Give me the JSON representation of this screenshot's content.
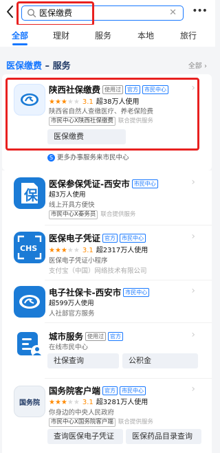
{
  "search": {
    "query": "医保缴费"
  },
  "tabs": [
    "全部",
    "理财",
    "服务",
    "本地",
    "旅行"
  ],
  "section": {
    "keyword": "医保缴费",
    "suffix": "– 服务",
    "all": "全部 ›"
  },
  "colors": {
    "accent": "#1677ff",
    "highlight": "#e8201f",
    "star": "#ff8a00"
  },
  "items": [
    {
      "title": "陕西社保缴费",
      "badges": [
        "使用过",
        "官方",
        "市民中心"
      ],
      "rating": "3.1",
      "users": "超38万人使用",
      "desc": "陕西省自然人查缴医疗、养老保险费",
      "tag": "市民中心X陕西社保缴费",
      "source": "联合提供服务",
      "actions": [
        "医保缴费"
      ],
      "icon": "si-social-security-icon"
    },
    {
      "hint": "更多办事服务来市民中心"
    },
    {
      "title": "医保参保凭证-西安市",
      "badges": [
        "市民中心"
      ],
      "users": "超3万人使用",
      "desc": "线上开具方便快",
      "tag": "市民中心X秦务员",
      "source": "联合提供服务",
      "icon": "bao-document-icon"
    },
    {
      "title": "医保电子凭证",
      "badges": [
        "官方",
        "市民中心"
      ],
      "rating": "3.1",
      "users": "超2317万人使用",
      "desc": "医保电子凭证小程序",
      "provider": "支付宝（中国）网络技术有限公司",
      "icon": "chs-icon"
    },
    {
      "title": "电子社保卡-西安市",
      "badges": [
        "市民中心"
      ],
      "users": "超599万人使用",
      "desc": "人社部官方服务",
      "icon": "si-card-icon"
    },
    {
      "title": "城市服务",
      "badges": [
        "使用过",
        "官方"
      ],
      "desc": "在线市民中心",
      "actions": [
        "社保查询",
        "公积金"
      ],
      "icon": "city-service-icon"
    },
    {
      "title": "国务院客户端",
      "badges": [
        "官方",
        "市民中心"
      ],
      "rating": "3.1",
      "users": "超3281万人使用",
      "desc": "你身边的中央人民政府",
      "tag": "市民中心X国务院客户端",
      "source": "联合提供服务",
      "actions": [
        "查询医保电子凭证",
        "医保药品目录查询"
      ],
      "logo_text": "国务院",
      "icon": "state-council-icon"
    }
  ]
}
